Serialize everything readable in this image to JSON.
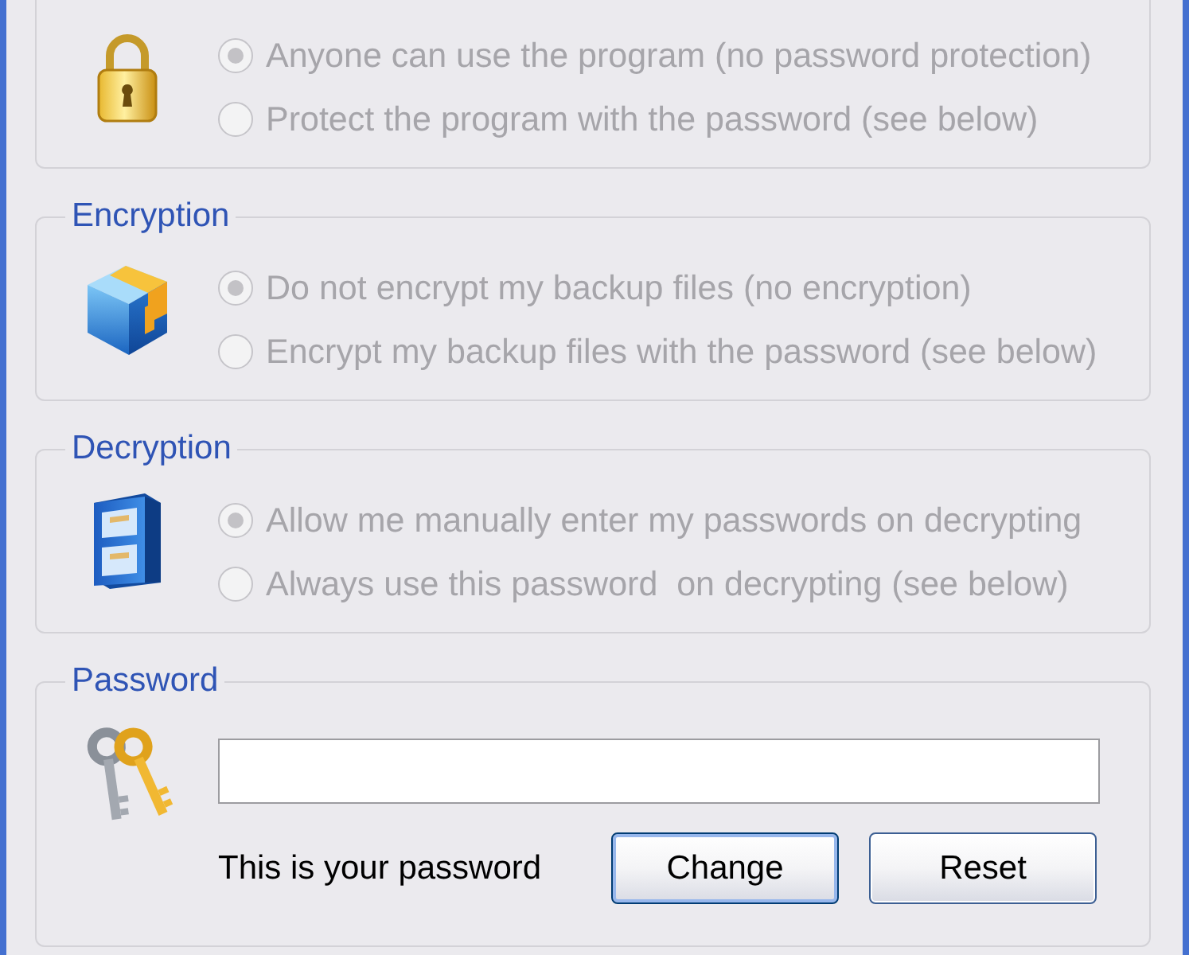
{
  "groups": [
    {
      "options": [
        {
          "label": "Anyone can use the program (no password protection)",
          "selected": true,
          "disabled": true
        },
        {
          "label": "Protect the program with the password (see below)",
          "selected": false,
          "disabled": true
        }
      ]
    },
    {
      "title": "Encryption",
      "options": [
        {
          "label": "Do not encrypt my backup files (no encryption)",
          "selected": true,
          "disabled": true
        },
        {
          "label": "Encrypt my backup files with the password (see below)",
          "selected": false,
          "disabled": true
        }
      ]
    },
    {
      "title": "Decryption",
      "options": [
        {
          "label": "Allow me manually enter my passwords on decrypting",
          "selected": true,
          "disabled": true
        },
        {
          "label": "Always use this password  on decrypting (see below)",
          "selected": false,
          "disabled": true
        }
      ]
    }
  ],
  "password": {
    "title": "Password",
    "caption": "This is your password",
    "buttons": [
      {
        "label": "Change",
        "default": true
      },
      {
        "label": "Reset",
        "default": false
      }
    ]
  }
}
